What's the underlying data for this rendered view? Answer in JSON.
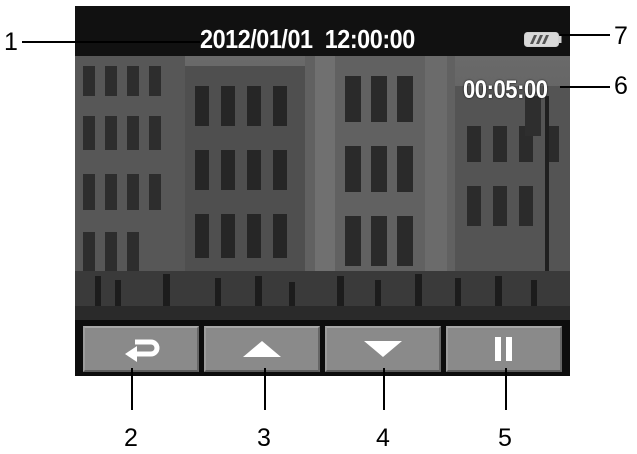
{
  "screen": {
    "datetime": "2012/01/01  12:00:00",
    "elapsed_time": "00:05:00",
    "battery_icon": "battery-full-icon"
  },
  "buttons": [
    {
      "name": "back-button",
      "icon": "return-arrow-icon"
    },
    {
      "name": "up-button",
      "icon": "up-triangle-icon"
    },
    {
      "name": "down-button",
      "icon": "down-triangle-icon"
    },
    {
      "name": "pause-button",
      "icon": "pause-icon"
    }
  ],
  "callouts": {
    "c1": "1",
    "c2": "2",
    "c3": "3",
    "c4": "4",
    "c5": "5",
    "c6": "6",
    "c7": "7"
  },
  "colors": {
    "screen_bg": "#0b0b0b",
    "button_face": "#8a8a8a",
    "text": "#ffffff"
  }
}
